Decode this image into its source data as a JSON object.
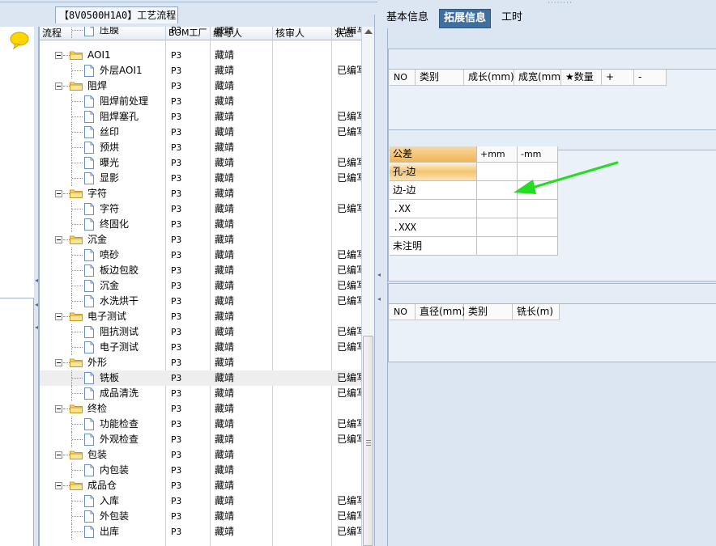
{
  "window": {
    "file_tab": "【8V0500H1A0】工艺流程"
  },
  "tree": {
    "columns": [
      "流程",
      "BOM工厂",
      "编写人",
      "核审人",
      "状态"
    ],
    "rows": [
      {
        "level": 2,
        "name": "压膜",
        "bom": "P3",
        "writer": "藏靖",
        "status": "已编写",
        "partial": true
      },
      {
        "level": 1,
        "name": "AOI1",
        "bom": "P3",
        "writer": "藏靖",
        "status": ""
      },
      {
        "level": 2,
        "name": "外层AOI1",
        "bom": "P3",
        "writer": "藏靖",
        "status": "已编写"
      },
      {
        "level": 1,
        "name": "阻焊",
        "bom": "P3",
        "writer": "藏靖",
        "status": ""
      },
      {
        "level": 2,
        "name": "阻焊前处理",
        "bom": "P3",
        "writer": "藏靖",
        "status": ""
      },
      {
        "level": 2,
        "name": "阻焊塞孔",
        "bom": "P3",
        "writer": "藏靖",
        "status": "已编写"
      },
      {
        "level": 2,
        "name": "丝印",
        "bom": "P3",
        "writer": "藏靖",
        "status": "已编写"
      },
      {
        "level": 2,
        "name": "预烘",
        "bom": "P3",
        "writer": "藏靖",
        "status": ""
      },
      {
        "level": 2,
        "name": "曝光",
        "bom": "P3",
        "writer": "藏靖",
        "status": "已编写"
      },
      {
        "level": 2,
        "name": "显影",
        "bom": "P3",
        "writer": "藏靖",
        "status": "已编写"
      },
      {
        "level": 1,
        "name": "字符",
        "bom": "P3",
        "writer": "藏靖",
        "status": ""
      },
      {
        "level": 2,
        "name": "字符",
        "bom": "P3",
        "writer": "藏靖",
        "status": "已编写"
      },
      {
        "level": 2,
        "name": "终固化",
        "bom": "P3",
        "writer": "藏靖",
        "status": ""
      },
      {
        "level": 1,
        "name": "沉金",
        "bom": "P3",
        "writer": "藏靖",
        "status": ""
      },
      {
        "level": 2,
        "name": "喷砂",
        "bom": "P3",
        "writer": "藏靖",
        "status": "已编写"
      },
      {
        "level": 2,
        "name": "板边包胶",
        "bom": "P3",
        "writer": "藏靖",
        "status": "已编写"
      },
      {
        "level": 2,
        "name": "沉金",
        "bom": "P3",
        "writer": "藏靖",
        "status": "已编写"
      },
      {
        "level": 2,
        "name": "水洗烘干",
        "bom": "P3",
        "writer": "藏靖",
        "status": "已编写"
      },
      {
        "level": 1,
        "name": "电子测试",
        "bom": "P3",
        "writer": "藏靖",
        "status": ""
      },
      {
        "level": 2,
        "name": "阻抗测试",
        "bom": "P3",
        "writer": "藏靖",
        "status": "已编写"
      },
      {
        "level": 2,
        "name": "电子测试",
        "bom": "P3",
        "writer": "藏靖",
        "status": "已编写"
      },
      {
        "level": 1,
        "name": "外形",
        "bom": "P3",
        "writer": "藏靖",
        "status": ""
      },
      {
        "level": 2,
        "name": "铣板",
        "bom": "P3",
        "writer": "藏靖",
        "status": "已编写",
        "selected": true
      },
      {
        "level": 2,
        "name": "成品清洗",
        "bom": "P3",
        "writer": "藏靖",
        "status": "已编写"
      },
      {
        "level": 1,
        "name": "终检",
        "bom": "P3",
        "writer": "藏靖",
        "status": ""
      },
      {
        "level": 2,
        "name": "功能检查",
        "bom": "P3",
        "writer": "藏靖",
        "status": "已编写"
      },
      {
        "level": 2,
        "name": "外观检查",
        "bom": "P3",
        "writer": "藏靖",
        "status": "已编写"
      },
      {
        "level": 1,
        "name": "包装",
        "bom": "P3",
        "writer": "藏靖",
        "status": ""
      },
      {
        "level": 2,
        "name": "内包装",
        "bom": "P3",
        "writer": "藏靖",
        "status": ""
      },
      {
        "level": 1,
        "name": "成品仓",
        "bom": "P3",
        "writer": "藏靖",
        "status": ""
      },
      {
        "level": 2,
        "name": "入库",
        "bom": "P3",
        "writer": "藏靖",
        "status": "已编写"
      },
      {
        "level": 2,
        "name": "外包装",
        "bom": "P3",
        "writer": "藏靖",
        "status": "已编写"
      },
      {
        "level": 2,
        "name": "出库",
        "bom": "P3",
        "writer": "藏靖",
        "status": "已编写"
      }
    ]
  },
  "tabs": [
    {
      "label": "基本信息",
      "active": false
    },
    {
      "label": "拓展信息",
      "active": true
    },
    {
      "label": "工时",
      "active": false
    }
  ],
  "material_grid": {
    "columns": [
      "NO",
      "类别",
      "成长(mm)",
      "成宽(mm)",
      "★数量",
      "+",
      "-"
    ]
  },
  "tolerance": {
    "header": [
      "公差",
      "+mm",
      "-mm"
    ],
    "rows": [
      {
        "label": "孔-边",
        "highlight": true
      },
      {
        "label": "边-边"
      },
      {
        "label": ".XX"
      },
      {
        "label": ".XXX"
      },
      {
        "label": "未注明"
      }
    ]
  },
  "drill_grid": {
    "columns": [
      "NO",
      "直径(mm)",
      "类别",
      "铣长(m)"
    ]
  },
  "colors": {
    "accent": "#3f6f9f",
    "annotation_arrow": "#22dd22",
    "panel_bg": "#dce6f2"
  },
  "icons": [
    "chat-bubble-icon",
    "folder-icon",
    "document-icon",
    "scroll-up-arrow-icon"
  ]
}
